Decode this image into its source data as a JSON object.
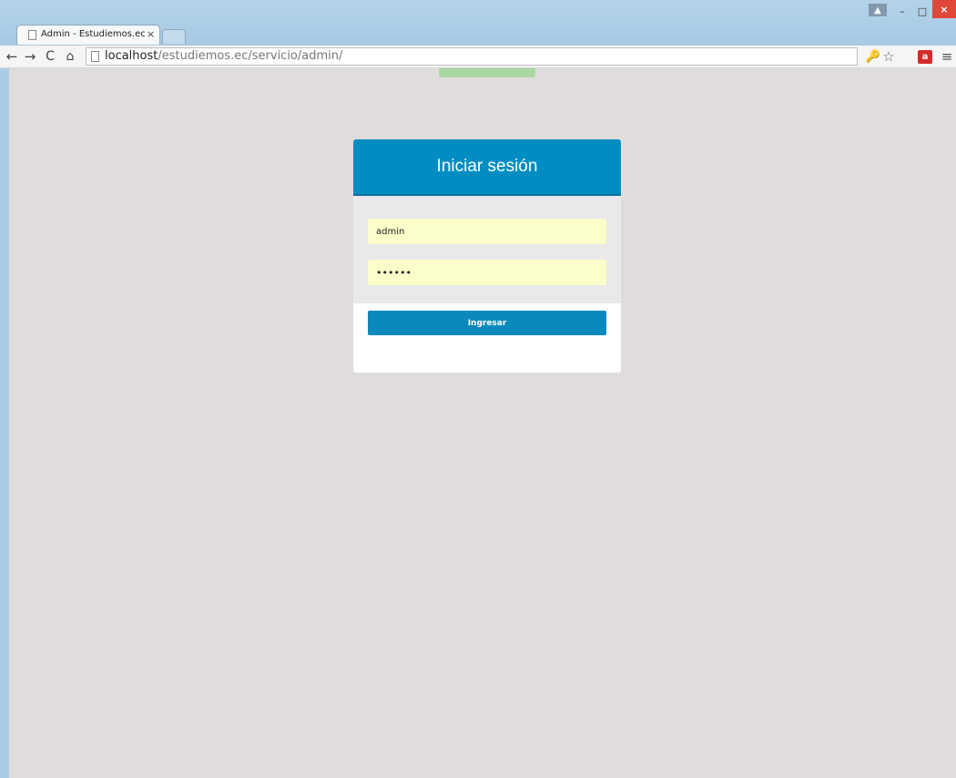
{
  "browser": {
    "tab_title": "Admin - Estudiemos.ec",
    "tab_close": "×",
    "url_host": "localhost",
    "url_path": "/estudiemos.ec/servicio/admin/",
    "window_controls": {
      "user": "▲",
      "minimize": "–",
      "maximize": "□",
      "close": "×"
    },
    "nav": {
      "back": "←",
      "forward": "→",
      "reload": "C",
      "home": "⌂"
    },
    "toolbar_icons": {
      "key": "🔑",
      "star": "☆",
      "extension": "a",
      "menu": "≡"
    }
  },
  "login": {
    "title": "Iniciar sesión",
    "username_value": "admin",
    "password_value": "••••••",
    "button_label": "Ingresar"
  },
  "colors": {
    "header_blue": "#008dc2",
    "button_blue": "#0a89bd",
    "field_yellow": "#fbfec8",
    "page_background": "#e0dcdc"
  }
}
